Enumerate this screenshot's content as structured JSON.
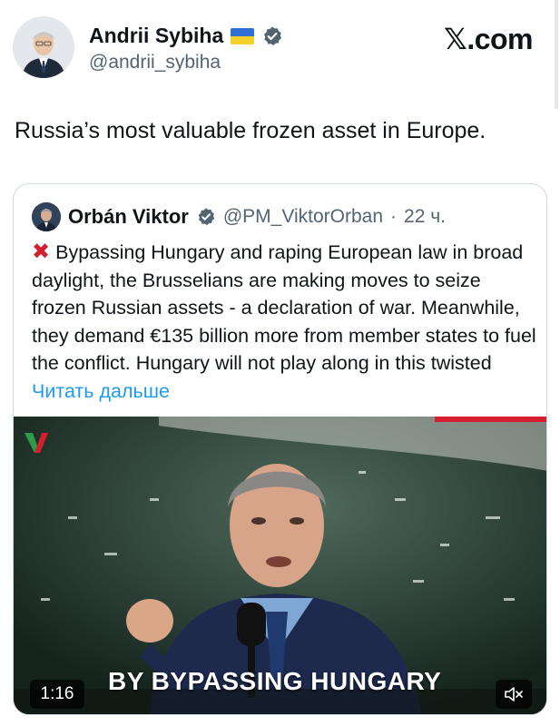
{
  "post": {
    "author_name": "Andrii Sybiha",
    "author_handle": "@andrii_sybiha",
    "text": "Russia’s most valuable frozen asset in Europe.",
    "flag_icon": "ukraine-flag-icon",
    "verified_icon": "verified-badge-icon"
  },
  "brand": {
    "logo_text": "𝕏.com"
  },
  "quote": {
    "author_name": "Orbán Viktor",
    "author_handle": "@PM_ViktorOrban",
    "separator": "·",
    "time": "22 ч.",
    "body": "Bypassing Hungary and raping European law in broad daylight, the Brusselians are making moves to seize frozen Russian assets - a declaration of war. Meanwhile, they demand €135 billion more from member states to fuel the conflict. Hungary will not play along in this twisted",
    "read_more": "Читать дальше",
    "cross_icon": "red-cross-icon"
  },
  "video": {
    "caption": "BY BYPASSING HUNGARY",
    "duration": "1:16",
    "mute_icon": "speaker-muted-icon"
  },
  "colors": {
    "link": "#1d9bf0",
    "secondary_text": "#536471",
    "cross_red": "#d3202f",
    "accent_red": "#d61f2c",
    "verified_gray": "#536471"
  }
}
